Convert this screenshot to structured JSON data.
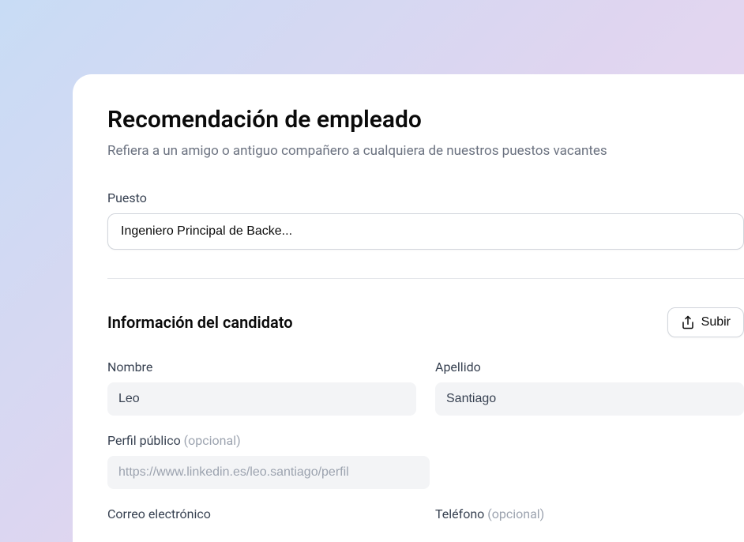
{
  "header": {
    "title": "Recomendación de empleado",
    "subtitle": "Refiera a un amigo o antiguo compañero a cualquiera de nuestros puestos vacantes"
  },
  "position": {
    "label": "Puesto",
    "selected": "Ingeniero Principal de Backe..."
  },
  "candidate": {
    "section_title": "Información del candidato",
    "upload_label": "Subir",
    "first_name": {
      "label": "Nombre",
      "value": "Leo"
    },
    "last_name": {
      "label": "Apellido",
      "value": "Santiago"
    },
    "profile": {
      "label": "Perfil público",
      "optional": "(opcional)",
      "placeholder": "https://www.linkedin.es/leo.santiago/perfil"
    },
    "email": {
      "label": "Correo electrónico"
    },
    "phone": {
      "label": "Teléfono",
      "optional": "(opcional)"
    }
  }
}
